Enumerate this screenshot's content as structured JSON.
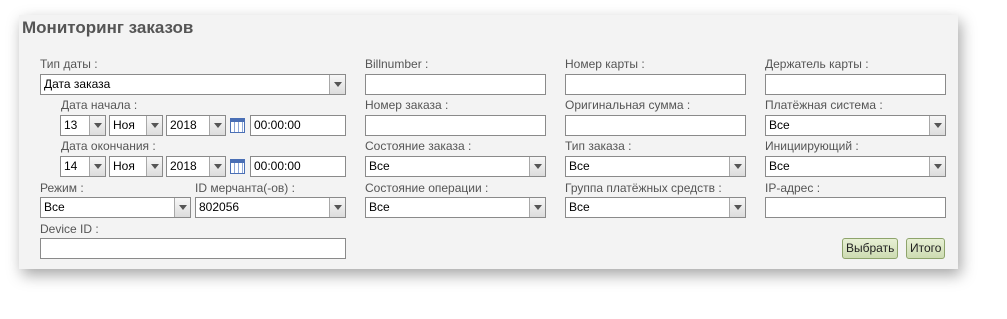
{
  "title": "Мониторинг заказов",
  "labels": {
    "date_type": "Тип даты :",
    "date_start": "Дата начала :",
    "date_end": "Дата окончания :",
    "mode": "Режим :",
    "merchant_id": "ID мерчанта(-ов) :",
    "device_id": "Device ID :",
    "billnumber": "Billnumber :",
    "order_number": "Номер заказа :",
    "order_state": "Состояние заказа :",
    "operation_state": "Состояние операции :",
    "card_number": "Номер карты :",
    "original_amount": "Оригинальная сумма :",
    "order_type": "Тип заказа :",
    "payment_group": "Группа платёжных средств :",
    "card_holder": "Держатель карты :",
    "payment_system": "Платёжная система :",
    "initiator": "Инициирующий :",
    "ip_address": "IP-адрес :"
  },
  "fields": {
    "date_type": "Дата заказа",
    "start_day": "13",
    "start_month": "Ноя",
    "start_year": "2018",
    "start_time": "00:00:00",
    "end_day": "14",
    "end_month": "Ноя",
    "end_year": "2018",
    "end_time": "00:00:00",
    "mode": "Все",
    "merchant_id": "802056",
    "device_id": "",
    "billnumber": "",
    "order_number": "",
    "order_state": "Все",
    "operation_state": "Все",
    "card_number": "",
    "original_amount": "",
    "order_type": "Все",
    "payment_group": "Все",
    "card_holder": "",
    "payment_system": "Все",
    "initiator": "Все",
    "ip_address": ""
  },
  "buttons": {
    "select": "Выбрать",
    "total": "Итого"
  },
  "icons": {
    "calendar": "calendar-icon",
    "dropdown": "chevron-down-icon"
  }
}
